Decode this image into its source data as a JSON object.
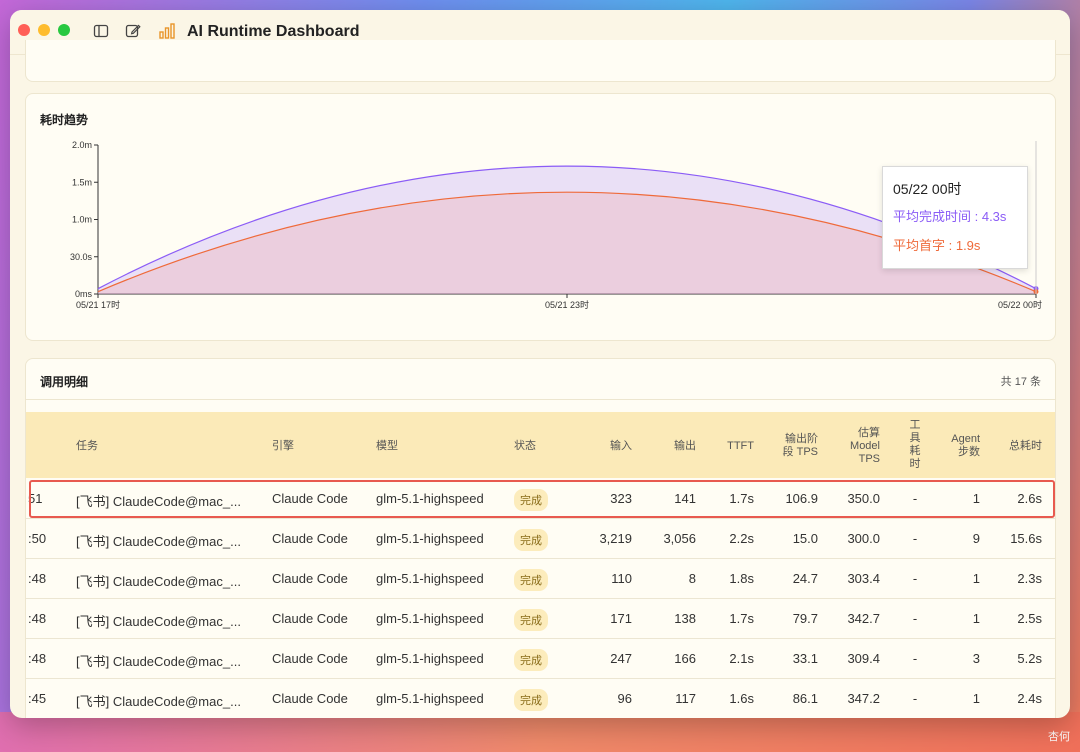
{
  "window": {
    "title": "AI Runtime Dashboard"
  },
  "trend": {
    "title": "耗时趋势",
    "tooltip": {
      "time": "05/22 00时",
      "avg_completion": "平均完成时间 : 4.3s",
      "avg_first": "平均首字 : 1.9s"
    }
  },
  "chart_data": {
    "type": "area",
    "title": "耗时趋势",
    "x_tick_labels": [
      "05/21 17时",
      "05/21 23时",
      "05/22 00时"
    ],
    "y_tick_labels": [
      "2.0m",
      "1.5m",
      "1.0m",
      "30.0s",
      "0ms"
    ],
    "ylim": [
      0,
      120
    ],
    "grid": false,
    "series": [
      {
        "name": "平均完成时间",
        "color": "#8b5cf6",
        "x": [
          0,
          0.5,
          1
        ],
        "values": [
          4.3,
          103,
          4.3
        ]
      },
      {
        "name": "平均首字",
        "color": "#ef6a3a",
        "x": [
          0,
          0.5,
          1
        ],
        "values": [
          1.9,
          82,
          1.9
        ]
      }
    ]
  },
  "calls": {
    "title": "调用明细",
    "count": "共 17 条",
    "headers": {
      "task": "任务",
      "engine": "引擎",
      "model": "模型",
      "status": "状态",
      "input": "输入",
      "output": "输出",
      "ttft": "TTFT",
      "out_tps": [
        "输出阶",
        "段 TPS"
      ],
      "model_tps": [
        "估算",
        "Model",
        "TPS"
      ],
      "tool": [
        "工",
        "具",
        "耗",
        "时"
      ],
      "agent": [
        "Agent",
        "步数"
      ],
      "total": "总耗时"
    },
    "rows": [
      {
        "time": "51",
        "task": "[飞书] ClaudeCode@mac_...",
        "engine": "Claude Code",
        "model": "glm-5.1-highspeed",
        "status": "完成",
        "input": "323",
        "output": "141",
        "ttft": "1.7s",
        "out_tps": "106.9",
        "model_tps": "350.0",
        "tool": "-",
        "agent": "1",
        "total": "2.6s"
      },
      {
        "time": ":50",
        "task": "[飞书] ClaudeCode@mac_...",
        "engine": "Claude Code",
        "model": "glm-5.1-highspeed",
        "status": "完成",
        "input": "3,219",
        "output": "3,056",
        "ttft": "2.2s",
        "out_tps": "15.0",
        "model_tps": "300.0",
        "tool": "-",
        "agent": "9",
        "total": "15.6s"
      },
      {
        "time": ":48",
        "task": "[飞书] ClaudeCode@mac_...",
        "engine": "Claude Code",
        "model": "glm-5.1-highspeed",
        "status": "完成",
        "input": "110",
        "output": "8",
        "ttft": "1.8s",
        "out_tps": "24.7",
        "model_tps": "303.4",
        "tool": "-",
        "agent": "1",
        "total": "2.3s"
      },
      {
        "time": ":48",
        "task": "[飞书] ClaudeCode@mac_...",
        "engine": "Claude Code",
        "model": "glm-5.1-highspeed",
        "status": "完成",
        "input": "171",
        "output": "138",
        "ttft": "1.7s",
        "out_tps": "79.7",
        "model_tps": "342.7",
        "tool": "-",
        "agent": "1",
        "total": "2.5s"
      },
      {
        "time": ":48",
        "task": "[飞书] ClaudeCode@mac_...",
        "engine": "Claude Code",
        "model": "glm-5.1-highspeed",
        "status": "完成",
        "input": "247",
        "output": "166",
        "ttft": "2.1s",
        "out_tps": "33.1",
        "model_tps": "309.4",
        "tool": "-",
        "agent": "3",
        "total": "5.2s"
      },
      {
        "time": ":45",
        "task": "[飞书] ClaudeCode@mac_...",
        "engine": "Claude Code",
        "model": "glm-5.1-highspeed",
        "status": "完成",
        "input": "96",
        "output": "117",
        "ttft": "1.6s",
        "out_tps": "86.1",
        "model_tps": "347.2",
        "tool": "-",
        "agent": "1",
        "total": "2.4s"
      }
    ]
  },
  "watermark": "杏何"
}
